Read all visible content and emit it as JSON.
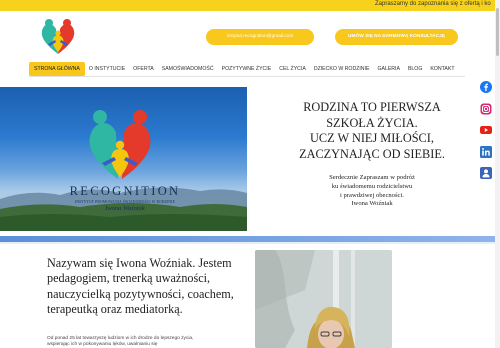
{
  "ticker": "Zapraszamy do zapoznania się z ofertą i ko",
  "header": {
    "email_button": "instytut.recognition@gmail.com",
    "consult_button": "UMÓW SIĘ NA DARMOWĄ KONSULTACJĘ"
  },
  "nav": {
    "items": [
      "Strona główna",
      "O instytucie",
      "Oferta",
      "Samoświadomość",
      "Pozytywne życie",
      "Cel życia",
      "Dziecko w rodzinie",
      "Galeria",
      "Blog",
      "Kontakt"
    ],
    "active_index": 0
  },
  "hero": {
    "brand_title": "RECOGNITION",
    "brand_subtitle": "INSTYTUT PROMOWANIA ŚWIADOMOŚCI W RODZINIE",
    "brand_name": "Iwona Woźniak",
    "heading": [
      "RODZINA TO PIERWSZA",
      "SZKOŁA ŻYCIA.",
      "UCZ W NIEJ MIŁOŚCI,",
      "ZACZYNAJĄC OD SIEBIE."
    ],
    "text": [
      "Serdecznie Zapraszam w podróż",
      "ku świadomemu rodzicielstwu",
      "i prawdziwej obecności.",
      "Iwona Woźniak"
    ]
  },
  "about": {
    "title": "Nazywam się Iwona Woźniak. Jestem pedagogiem, trenerką uważności, nauczycielką pozytywności, coachem, terapeutką oraz mediatorką.",
    "text": "Od ponad 25 lat towarzyszę ludziom w ich drodze do lepszego życia, wspierając ich w pokonywaniu lęków, uwalnianiu się"
  },
  "social": [
    "facebook-icon",
    "instagram-icon",
    "youtube-icon",
    "linkedin-icon",
    "profile-icon"
  ],
  "colors": {
    "accent_yellow": "#f8c81c",
    "divider_blue": "#5b8fd8",
    "facebook": "#1877f2",
    "instagram": "#d62976",
    "youtube": "#e62117",
    "linkedin": "#2e73c0",
    "profile": "#3b63b8"
  }
}
